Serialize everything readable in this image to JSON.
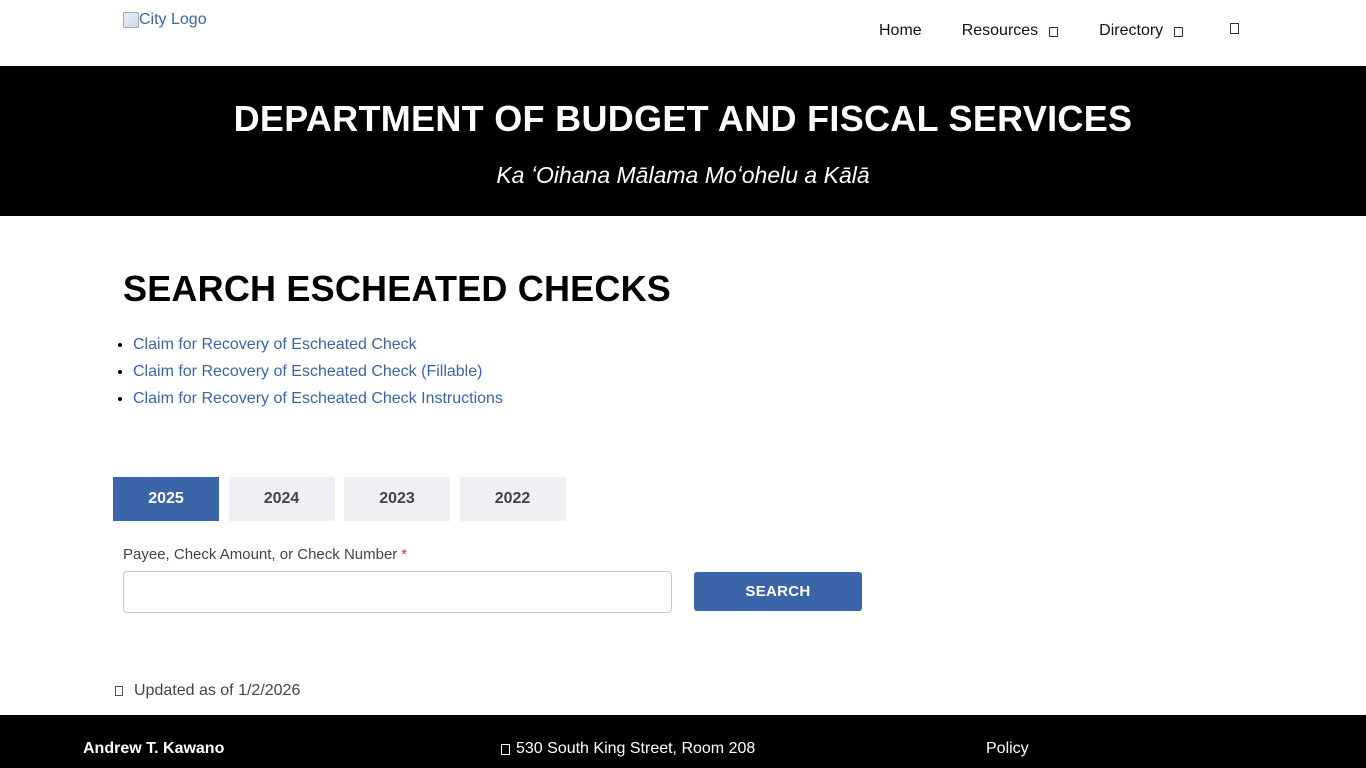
{
  "header": {
    "logo_alt": "City Logo",
    "nav": [
      {
        "label": "Home"
      },
      {
        "label": "Resources"
      },
      {
        "label": "Directory"
      }
    ]
  },
  "hero": {
    "title": "DEPARTMENT OF BUDGET AND FISCAL SERVICES",
    "subtitle": "Ka ʻOihana Mālama Moʻohelu a Kālā"
  },
  "main": {
    "title": "SEARCH ESCHEATED CHECKS",
    "links": [
      {
        "label": "Claim for Recovery of Escheated Check"
      },
      {
        "label": "Claim for Recovery of Escheated Check (Fillable)"
      },
      {
        "label": "Claim for Recovery of Escheated Check Instructions"
      }
    ],
    "year_tabs": [
      {
        "label": "2025",
        "active": true
      },
      {
        "label": "2024",
        "active": false
      },
      {
        "label": "2023",
        "active": false
      },
      {
        "label": "2022",
        "active": false
      }
    ],
    "search": {
      "label": "Payee, Check Amount, or Check Number",
      "required_marker": "*",
      "value": "",
      "button_label": "SEARCH"
    },
    "updated": "Updated as of 1/2/2026"
  },
  "footer": {
    "name": "Andrew T. Kawano",
    "address": "530 South King Street, Room 208",
    "policy": "Policy"
  },
  "colors": {
    "accent": "#3a65a8",
    "hero_bg": "#000000",
    "tab_inactive_bg": "#eef0f3"
  }
}
